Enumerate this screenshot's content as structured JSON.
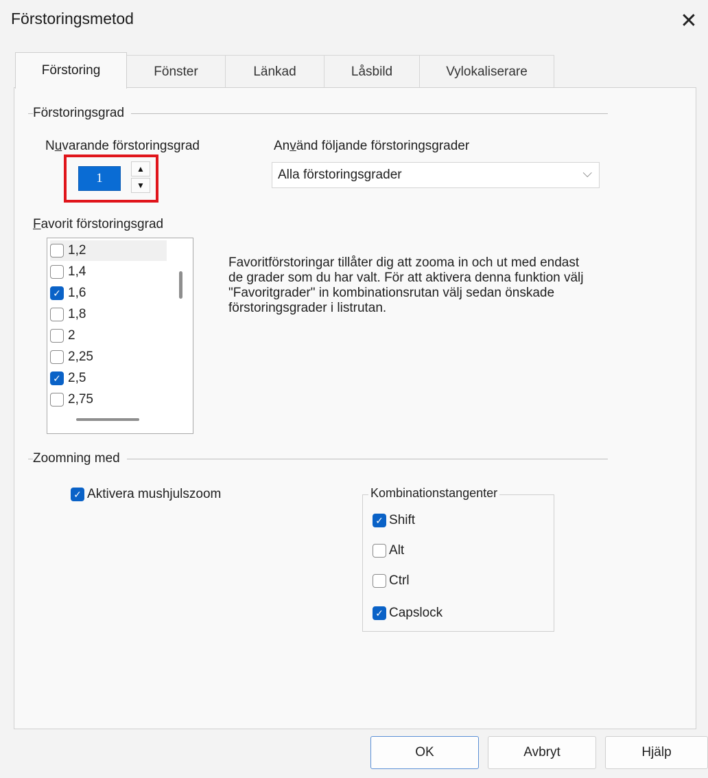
{
  "window": {
    "title": "Förstoringsmetod",
    "close_symbol": "✕"
  },
  "tabs": [
    {
      "label": "Förstoring",
      "active": true
    },
    {
      "label": "Fönster",
      "active": false
    },
    {
      "label": "Länkad",
      "active": false
    },
    {
      "label": "Låsbild",
      "active": false
    },
    {
      "label": "Vylokaliserare",
      "active": false
    }
  ],
  "magnification": {
    "group_label": "Förstoringsgrad",
    "current_label_prefix": "N",
    "current_label_accel": "u",
    "current_label_rest": "varande förstoringsgrad",
    "current_value": "1",
    "up_symbol": "▲",
    "down_symbol": "▼",
    "use_label_prefix": "An",
    "use_label_accel": "v",
    "use_label_rest": "änd följande förstoringsgrader",
    "use_selected": "Alla förstoringsgrader",
    "chevron_symbol": "⌵",
    "favorite_label_accel": "F",
    "favorite_label_rest": "avorit förstoringsgrad",
    "favorites": [
      {
        "label": "1,2",
        "checked": false
      },
      {
        "label": "1,4",
        "checked": false
      },
      {
        "label": "1,6",
        "checked": true
      },
      {
        "label": "1,8",
        "checked": false
      },
      {
        "label": "2",
        "checked": false
      },
      {
        "label": "2,25",
        "checked": false
      },
      {
        "label": "2,5",
        "checked": true
      },
      {
        "label": "2,75",
        "checked": false
      }
    ],
    "help_text": "Favoritförstoringar tillåter dig att zooma in och ut med endast de grader som du har valt. För att aktivera denna funktion välj \"Favoritgrader\" in kombinationsrutan välj sedan önskade förstoringsgrader i listrutan."
  },
  "zoom": {
    "group_label": "Zoomning med",
    "mouse_wheel": {
      "prefix": "A",
      "accel": "k",
      "rest": "tivera mushjulszoom",
      "checked": true
    },
    "keys_legend": "Kombinationstangenter",
    "keys": [
      {
        "prefix": "",
        "accel": "S",
        "rest": "hift",
        "checked": true
      },
      {
        "prefix": "",
        "accel": "A",
        "rest": "lt",
        "checked": false
      },
      {
        "prefix": "C",
        "accel": "t",
        "rest": "rl",
        "checked": false
      },
      {
        "prefix": "",
        "accel": "",
        "rest": "Capslock",
        "checked": true
      }
    ]
  },
  "buttons": {
    "ok": "OK",
    "cancel": "Avbryt",
    "help": "Hjälp"
  },
  "check_symbol": "✓"
}
